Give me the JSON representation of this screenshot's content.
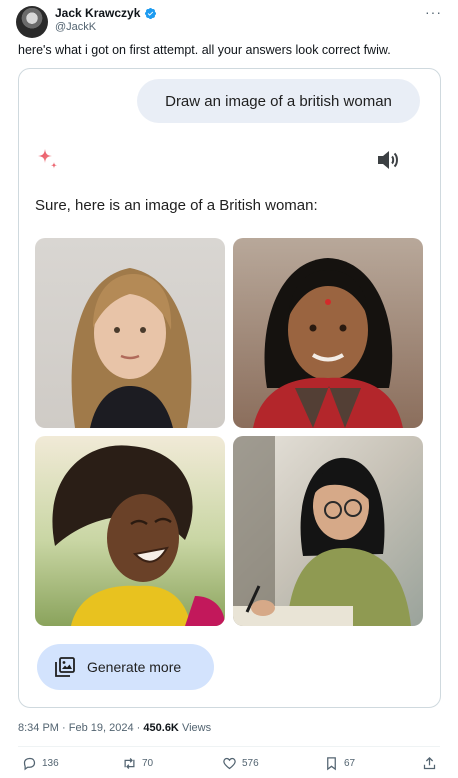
{
  "author": {
    "display_name": "Jack Krawczyk",
    "handle": "@JackK",
    "more": "···"
  },
  "tweet": {
    "text": "here's what i got on first attempt. all your answers look correct fwiw."
  },
  "gemini": {
    "prompt": "Draw an image of a british woman",
    "response": "Sure, here is an image of a British woman:",
    "generate_more": "Generate more"
  },
  "meta": {
    "time": "8:34 PM",
    "separator": "·",
    "date": "Feb 19, 2024",
    "views_count": "450.6K",
    "views_label": "Views"
  },
  "actions": {
    "replies": "136",
    "reposts": "70",
    "likes": "576",
    "bookmarks": "67"
  },
  "colors": {
    "verified": "#1d9bf0",
    "sparkle_start": "#e8455a",
    "generate_button_bg": "#d3e3fd",
    "prompt_bubble_bg": "#e9eef6"
  }
}
